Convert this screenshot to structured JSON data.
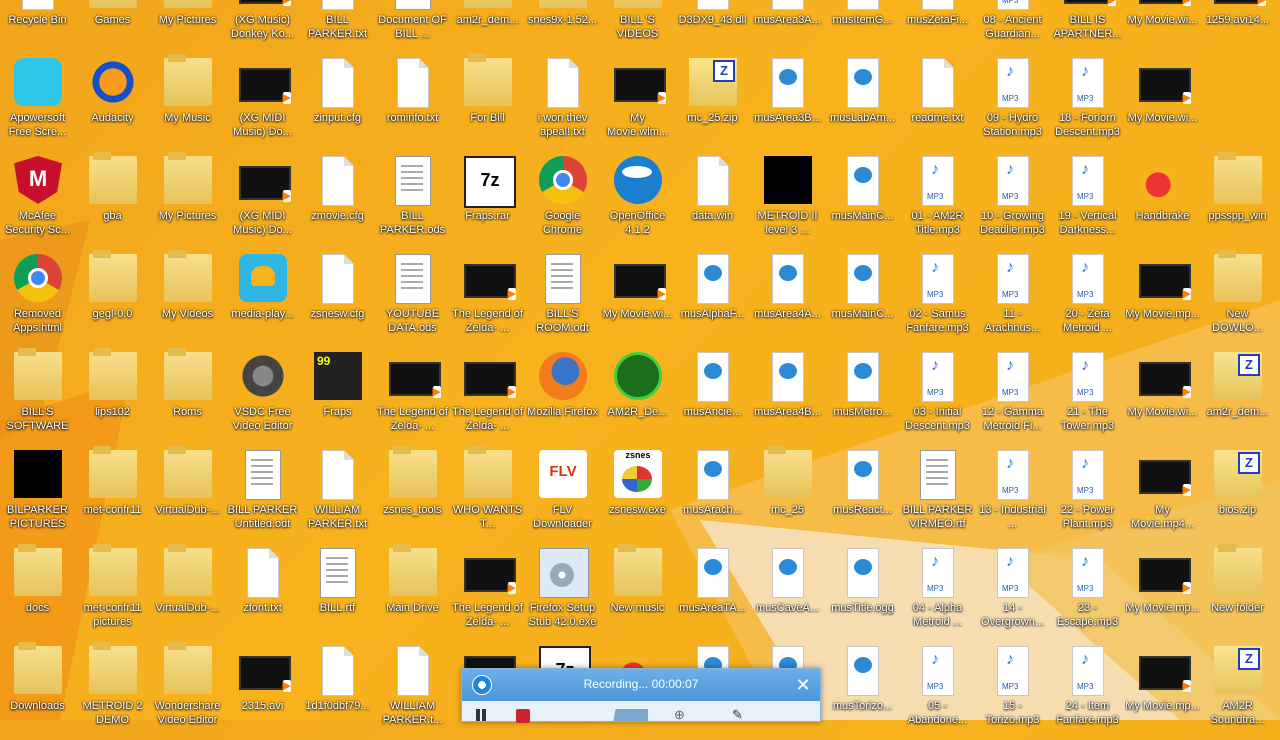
{
  "desktop": {
    "rows": [
      [
        {
          "label": "Recycle Bin",
          "icon": "recycle-bin-icon",
          "kind": "file"
        },
        {
          "label": "Games",
          "icon": "folder-icon",
          "kind": "folder"
        },
        {
          "label": "My Pictures",
          "icon": "folder-icon",
          "kind": "folder"
        },
        {
          "label": "(XG Music) Donkey Ko...",
          "icon": "video-file-icon",
          "kind": "video"
        },
        {
          "label": "BILL PARKER.txt",
          "icon": "text-file-icon",
          "kind": "file"
        },
        {
          "label": "Document OF BILL ...",
          "icon": "document-icon",
          "kind": "doc"
        },
        {
          "label": "am2r_dem...",
          "icon": "zip-file-icon",
          "kind": "zip"
        },
        {
          "label": "snes9x-1.52...",
          "icon": "folder-icon",
          "kind": "folder"
        },
        {
          "label": "BILL 'S VIDEOS",
          "icon": "folder-icon",
          "kind": "folder"
        },
        {
          "label": "D3DX9_43.dll",
          "icon": "dll-file-icon",
          "kind": "file"
        },
        {
          "label": "musArea3A...",
          "icon": "audio-file-icon",
          "kind": "wmp"
        },
        {
          "label": "musItemG...",
          "icon": "audio-file-icon",
          "kind": "wmp"
        },
        {
          "label": "musZetaFi...",
          "icon": "audio-file-icon",
          "kind": "wmp"
        },
        {
          "label": "08 - Ancient Guardian...",
          "icon": "mp3-file-icon",
          "kind": "mp3"
        },
        {
          "label": "BILL IS APARTNER...",
          "icon": "video-file-icon",
          "kind": "video"
        },
        {
          "label": "My Movie.wi...",
          "icon": "video-file-icon",
          "kind": "video"
        },
        {
          "label": "1259.avi14...",
          "icon": "video-file-icon",
          "kind": "video"
        }
      ],
      [
        {
          "label": "Apowersoft Free Scre...",
          "icon": "apowersoft-icon",
          "kind": "apow"
        },
        {
          "label": "Audacity",
          "icon": "audacity-icon",
          "kind": "aud"
        },
        {
          "label": "My Music",
          "icon": "folder-music-icon",
          "kind": "folder"
        },
        {
          "label": "(XG MIDI Music) Do...",
          "icon": "video-file-icon",
          "kind": "video"
        },
        {
          "label": "zinput.cfg",
          "icon": "text-file-icon",
          "kind": "file"
        },
        {
          "label": "rominfo.txt",
          "icon": "text-file-icon",
          "kind": "file"
        },
        {
          "label": "For Bill",
          "icon": "folder-icon",
          "kind": "folder"
        },
        {
          "label": "i won thev apeal!.txt",
          "icon": "text-file-icon",
          "kind": "file"
        },
        {
          "label": "My Movie.wlm...",
          "icon": "video-file-icon",
          "kind": "video"
        },
        {
          "label": "mc_25.zip",
          "icon": "zip-file-icon",
          "kind": "zip"
        },
        {
          "label": "musArea3B...",
          "icon": "audio-file-icon",
          "kind": "wmp"
        },
        {
          "label": "musLabAm...",
          "icon": "audio-file-icon",
          "kind": "wmp"
        },
        {
          "label": "readme.txt",
          "icon": "text-file-icon",
          "kind": "file"
        },
        {
          "label": "09 - Hydro Station.mp3",
          "icon": "mp3-file-icon",
          "kind": "mp3"
        },
        {
          "label": "18 - Forlorn Descent.mp3",
          "icon": "mp3-file-icon",
          "kind": "mp3"
        },
        {
          "label": "My Movie.wi...",
          "icon": "video-file-icon",
          "kind": "video"
        }
      ],
      [
        {
          "label": "McAfee Security Sc...",
          "icon": "mcafee-icon",
          "kind": "mcafee"
        },
        {
          "label": "gba",
          "icon": "folder-icon",
          "kind": "folder"
        },
        {
          "label": "My Pictures",
          "icon": "folder-pictures-icon",
          "kind": "folder"
        },
        {
          "label": "(XG MIDI Music) Do...",
          "icon": "video-file-icon",
          "kind": "video"
        },
        {
          "label": "zmovie.cfg",
          "icon": "text-file-icon",
          "kind": "file"
        },
        {
          "label": "BILL PARKER.ods",
          "icon": "spreadsheet-icon",
          "kind": "doc"
        },
        {
          "label": "Fraps.rar",
          "icon": "7zip-icon",
          "kind": "zz"
        },
        {
          "label": "Google Chrome",
          "icon": "chrome-icon",
          "kind": "chrome"
        },
        {
          "label": "OpenOffice 4.1.2",
          "icon": "openoffice-icon",
          "kind": "oo"
        },
        {
          "label": "data.win",
          "icon": "file-icon",
          "kind": "file"
        },
        {
          "label": "METROID II level 3 ...",
          "icon": "video-file-icon",
          "kind": "black"
        },
        {
          "label": "musMainC...",
          "icon": "audio-file-icon",
          "kind": "wmp"
        },
        {
          "label": "01 - AM2R Title.mp3",
          "icon": "mp3-file-icon",
          "kind": "mp3"
        },
        {
          "label": "10 - Growing Deadlier.mp3",
          "icon": "mp3-file-icon",
          "kind": "mp3"
        },
        {
          "label": "19 - Vertical Darkness...",
          "icon": "mp3-file-icon",
          "kind": "mp3"
        },
        {
          "label": "Handbrake",
          "icon": "handbrake-icon",
          "kind": "hand"
        },
        {
          "label": "ppsspp_win",
          "icon": "folder-icon",
          "kind": "folder"
        }
      ],
      [
        {
          "label": "Removed Apps.html",
          "icon": "chrome-icon",
          "kind": "chrome"
        },
        {
          "label": "gegl-0.0",
          "icon": "folder-icon",
          "kind": "folder"
        },
        {
          "label": "My Videos",
          "icon": "folder-videos-icon",
          "kind": "folder"
        },
        {
          "label": "media-play...",
          "icon": "media-player-icon",
          "kind": "media"
        },
        {
          "label": "zsnesw.cfg",
          "icon": "text-file-icon",
          "kind": "file"
        },
        {
          "label": "YOUTUBE DATA.ods",
          "icon": "spreadsheet-icon",
          "kind": "doc"
        },
        {
          "label": "The Legend of Zelda- ...",
          "icon": "video-file-icon",
          "kind": "video"
        },
        {
          "label": "BILL'S ROOM.odt",
          "icon": "document-icon",
          "kind": "doc"
        },
        {
          "label": "My Movie.wi...",
          "icon": "video-file-icon",
          "kind": "video"
        },
        {
          "label": "musAlphaF...",
          "icon": "audio-file-icon",
          "kind": "wmp"
        },
        {
          "label": "musArea4A...",
          "icon": "audio-file-icon",
          "kind": "wmp"
        },
        {
          "label": "musMainC...",
          "icon": "audio-file-icon",
          "kind": "wmp"
        },
        {
          "label": "02 - Samus Fanfare.mp3",
          "icon": "mp3-file-icon",
          "kind": "mp3"
        },
        {
          "label": "11 - Arachnus...",
          "icon": "mp3-file-icon",
          "kind": "mp3"
        },
        {
          "label": "20 - Zeta Metroid ...",
          "icon": "mp3-file-icon",
          "kind": "mp3"
        },
        {
          "label": "My Movie.mp...",
          "icon": "video-file-icon",
          "kind": "video"
        },
        {
          "label": "New DOWLO...",
          "icon": "folder-icon",
          "kind": "folder"
        }
      ],
      [
        {
          "label": "BILL'S SOFTWARE",
          "icon": "folder-icon",
          "kind": "folder"
        },
        {
          "label": "lips102",
          "icon": "folder-icon",
          "kind": "folder"
        },
        {
          "label": "Roms",
          "icon": "folder-icon",
          "kind": "folder"
        },
        {
          "label": "VSDC Free Video Editor",
          "icon": "vsdc-icon",
          "kind": "vsdc"
        },
        {
          "label": "Fraps",
          "icon": "fraps-icon",
          "kind": "fraps"
        },
        {
          "label": "The Legend of Zelda- ...",
          "icon": "video-file-icon",
          "kind": "video"
        },
        {
          "label": "The Legend of Zelda- ...",
          "icon": "video-file-icon",
          "kind": "video"
        },
        {
          "label": "Mozilla Firefox",
          "icon": "firefox-icon",
          "kind": "firefox"
        },
        {
          "label": "AM2R_De...",
          "icon": "am2r-icon",
          "kind": "am2r"
        },
        {
          "label": "musAncie...",
          "icon": "audio-file-icon",
          "kind": "wmp"
        },
        {
          "label": "musArea4B...",
          "icon": "audio-file-icon",
          "kind": "wmp"
        },
        {
          "label": "musMetro...",
          "icon": "audio-file-icon",
          "kind": "wmp"
        },
        {
          "label": "03 - Initial Descent.mp3",
          "icon": "mp3-file-icon",
          "kind": "mp3"
        },
        {
          "label": "12 - Gamma Metroid Fi...",
          "icon": "mp3-file-icon",
          "kind": "mp3"
        },
        {
          "label": "21 - The Tower.mp3",
          "icon": "mp3-file-icon",
          "kind": "mp3"
        },
        {
          "label": "My Movie.wi...",
          "icon": "video-file-icon",
          "kind": "video"
        },
        {
          "label": "am2r_dem...",
          "icon": "zip-file-icon",
          "kind": "zip"
        }
      ],
      [
        {
          "label": "BILPARKER PICTURES",
          "icon": "folder-icon",
          "kind": "black"
        },
        {
          "label": "met-confr11",
          "icon": "folder-icon",
          "kind": "folder"
        },
        {
          "label": "VirtualDub-...",
          "icon": "folder-icon",
          "kind": "folder"
        },
        {
          "label": "BILL PARKER Untitled.odt",
          "icon": "document-icon",
          "kind": "doc"
        },
        {
          "label": "WILLIAM PARKER.txt",
          "icon": "text-file-icon",
          "kind": "file"
        },
        {
          "label": "zsnes_tools",
          "icon": "folder-icon",
          "kind": "folder"
        },
        {
          "label": "WHO WANTS T...",
          "icon": "folder-icon",
          "kind": "folder"
        },
        {
          "label": "FLV Downloader",
          "icon": "flv-icon",
          "kind": "flv"
        },
        {
          "label": "zsnesw.exe",
          "icon": "zsnes-icon",
          "kind": "znes"
        },
        {
          "label": "musArach...",
          "icon": "audio-file-icon",
          "kind": "wmp"
        },
        {
          "label": "mc_25",
          "icon": "folder-icon",
          "kind": "folder"
        },
        {
          "label": "musReact...",
          "icon": "audio-file-icon",
          "kind": "wmp"
        },
        {
          "label": "BILL PARKER VIRMEO.rtf",
          "icon": "document-icon",
          "kind": "doc"
        },
        {
          "label": "13 - Industrial ...",
          "icon": "mp3-file-icon",
          "kind": "mp3"
        },
        {
          "label": "22 - Power Plant.mp3",
          "icon": "mp3-file-icon",
          "kind": "mp3"
        },
        {
          "label": "My Movie.mp4...",
          "icon": "video-file-icon",
          "kind": "video"
        },
        {
          "label": "bios.zip",
          "icon": "zip-file-icon",
          "kind": "zip"
        }
      ],
      [
        {
          "label": "docs",
          "icon": "folder-icon",
          "kind": "folder"
        },
        {
          "label": "met-confr11 pictures",
          "icon": "folder-icon",
          "kind": "folder"
        },
        {
          "label": "VirtualDub-...",
          "icon": "folder-icon",
          "kind": "folder"
        },
        {
          "label": "zfont.txt",
          "icon": "text-file-icon",
          "kind": "file"
        },
        {
          "label": "BILL.rtf",
          "icon": "document-icon",
          "kind": "doc"
        },
        {
          "label": "Main Drive",
          "icon": "folder-icon",
          "kind": "folder"
        },
        {
          "label": "The Legend of Zelda- ...",
          "icon": "video-file-icon",
          "kind": "video"
        },
        {
          "label": "Firefox Setup Stub 42.0.exe",
          "icon": "installer-icon",
          "kind": "setup"
        },
        {
          "label": "New music",
          "icon": "folder-icon",
          "kind": "folder"
        },
        {
          "label": "musAreaTA...",
          "icon": "audio-file-icon",
          "kind": "wmp"
        },
        {
          "label": "musCaveA...",
          "icon": "audio-file-icon",
          "kind": "wmp"
        },
        {
          "label": "musTitle.ogg",
          "icon": "audio-file-icon",
          "kind": "wmp"
        },
        {
          "label": "04 - Alpha Metroid ...",
          "icon": "mp3-file-icon",
          "kind": "mp3"
        },
        {
          "label": "14 - Overgrown...",
          "icon": "mp3-file-icon",
          "kind": "mp3"
        },
        {
          "label": "23 - Escape.mp3",
          "icon": "mp3-file-icon",
          "kind": "mp3"
        },
        {
          "label": "My Movie.mp...",
          "icon": "video-file-icon",
          "kind": "video"
        },
        {
          "label": "New folder",
          "icon": "folder-icon",
          "kind": "folder"
        }
      ],
      [
        {
          "label": "Downloads",
          "icon": "folder-downloads-icon",
          "kind": "folder"
        },
        {
          "label": "METROID 2 DEMO",
          "icon": "folder-icon",
          "kind": "folder"
        },
        {
          "label": "Wondershare Video Editor",
          "icon": "folder-icon",
          "kind": "folder"
        },
        {
          "label": "2315.avi",
          "icon": "video-file-icon",
          "kind": "video"
        },
        {
          "label": "1d1f0dbf79...",
          "icon": "file-icon",
          "kind": "file"
        },
        {
          "label": "WILLIAM PARKER.t...",
          "icon": "text-file-icon",
          "kind": "file"
        },
        {
          "label": "",
          "icon": "video-file-icon",
          "kind": "video"
        },
        {
          "label": "",
          "icon": "7zip-icon",
          "kind": "zz"
        },
        {
          "label": "",
          "icon": "am2r-icon",
          "kind": "hand"
        },
        {
          "label": "",
          "icon": "audio-file-icon",
          "kind": "wmp"
        },
        {
          "label": "",
          "icon": "audio-file-icon",
          "kind": "wmp"
        },
        {
          "label": "musTorizo...",
          "icon": "audio-file-icon",
          "kind": "wmp"
        },
        {
          "label": "05 - Abandone...",
          "icon": "mp3-file-icon",
          "kind": "mp3"
        },
        {
          "label": "15 - Torizo.mp3",
          "icon": "mp3-file-icon",
          "kind": "mp3"
        },
        {
          "label": "24 - Item Fanfare.mp3",
          "icon": "mp3-file-icon",
          "kind": "mp3"
        },
        {
          "label": "My Movie.mp...",
          "icon": "video-file-icon",
          "kind": "video"
        },
        {
          "label": "AM2R Soundtra...",
          "icon": "zip-file-icon",
          "kind": "zip"
        }
      ]
    ]
  },
  "recorder": {
    "status": "Recording... 00:00:07",
    "close_symbol": "✕",
    "zoom_symbol": "⊕",
    "pen_symbol": "✎"
  },
  "colors": {
    "wallpaper": "#f6ad1a",
    "recorder_titlebar": "#4a96d8",
    "stop_button": "#d0202a"
  }
}
